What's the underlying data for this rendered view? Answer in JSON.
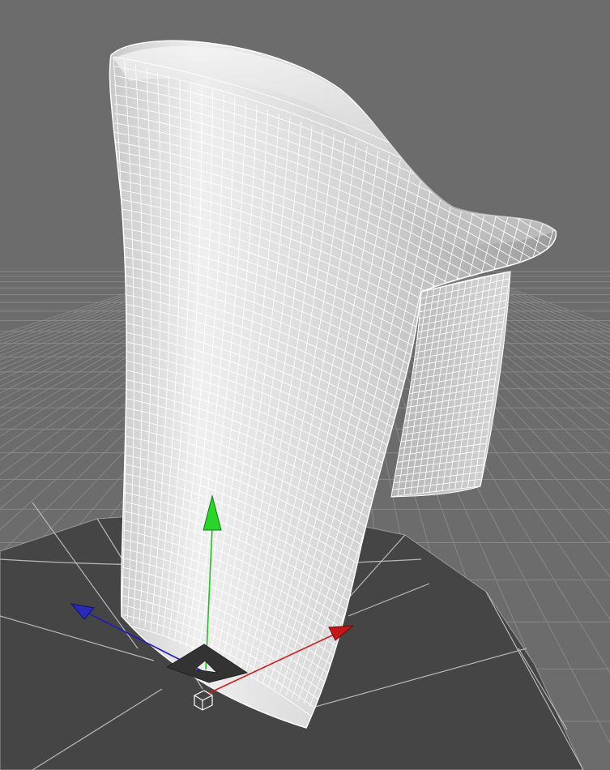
{
  "viewport": {
    "background_color": "#6c6c6c",
    "ground_grid_color": "#8a8a8a",
    "platform_color": "#444444",
    "platform_line_color": "#c8c8c8",
    "mesh_fill_light": "#e8e8e8",
    "mesh_fill_dark": "#8f8f8f",
    "mesh_wire_color": "#ffffff"
  },
  "object": {
    "type": "chair-shell-mesh",
    "selected": true
  },
  "gizmo": {
    "type": "move-manipulator",
    "axes": [
      {
        "axis": "x",
        "color": "#cc1f1f",
        "icon": "x-axis-arrow-icon"
      },
      {
        "axis": "y",
        "color": "#1fbf1f",
        "icon": "y-axis-arrow-icon"
      },
      {
        "axis": "z",
        "color": "#2020b0",
        "icon": "z-axis-arrow-icon"
      }
    ],
    "center_icon": "pivot-cube-icon",
    "plane_handle_color": "#333333"
  }
}
